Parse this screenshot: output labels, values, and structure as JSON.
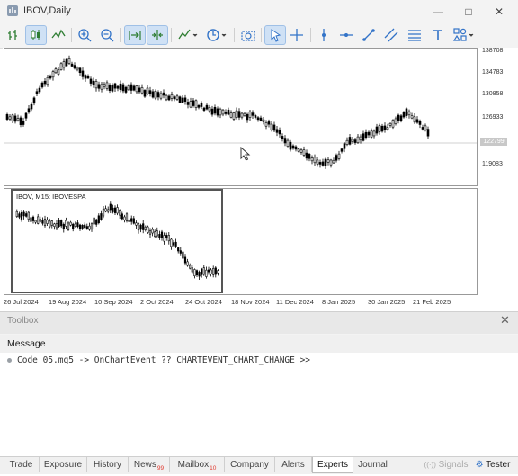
{
  "window": {
    "title": "IBOV,Daily",
    "minimize_icon": "minimize-icon",
    "maximize_icon": "maximize-icon",
    "close_icon": "close-icon"
  },
  "chart": {
    "price_axis": [
      "138708",
      "134783",
      "130858",
      "126933",
      "122799",
      "119083"
    ],
    "current_price": "122799",
    "time_axis": [
      "26 Jul 2024",
      "19 Aug 2024",
      "10 Sep 2024",
      "2 Oct 2024",
      "24 Oct 2024",
      "18 Nov 2024",
      "11 Dec 2024",
      "8 Jan 2025",
      "30 Jan 2025",
      "21 Feb 2025"
    ],
    "sub_caption": "IBOV, M15:  IBOVESPA",
    "colors": {
      "candle": "#000000",
      "bid_line": "#c0c0c0"
    }
  },
  "toolbox": {
    "title": "Toolbox",
    "column": "Message",
    "log": "Code 05.mq5 -> OnChartEvent ?? CHARTEVENT_CHART_CHANGE >>",
    "tabs": [
      {
        "label": "Trade"
      },
      {
        "label": "Exposure"
      },
      {
        "label": "History"
      },
      {
        "label": "News",
        "badge": "99"
      },
      {
        "label": "Mailbox",
        "badge": "10"
      },
      {
        "label": "Company"
      },
      {
        "label": "Alerts"
      },
      {
        "label": "Experts"
      },
      {
        "label": "Journal"
      }
    ],
    "signals": "Signals",
    "tester": "Tester"
  }
}
